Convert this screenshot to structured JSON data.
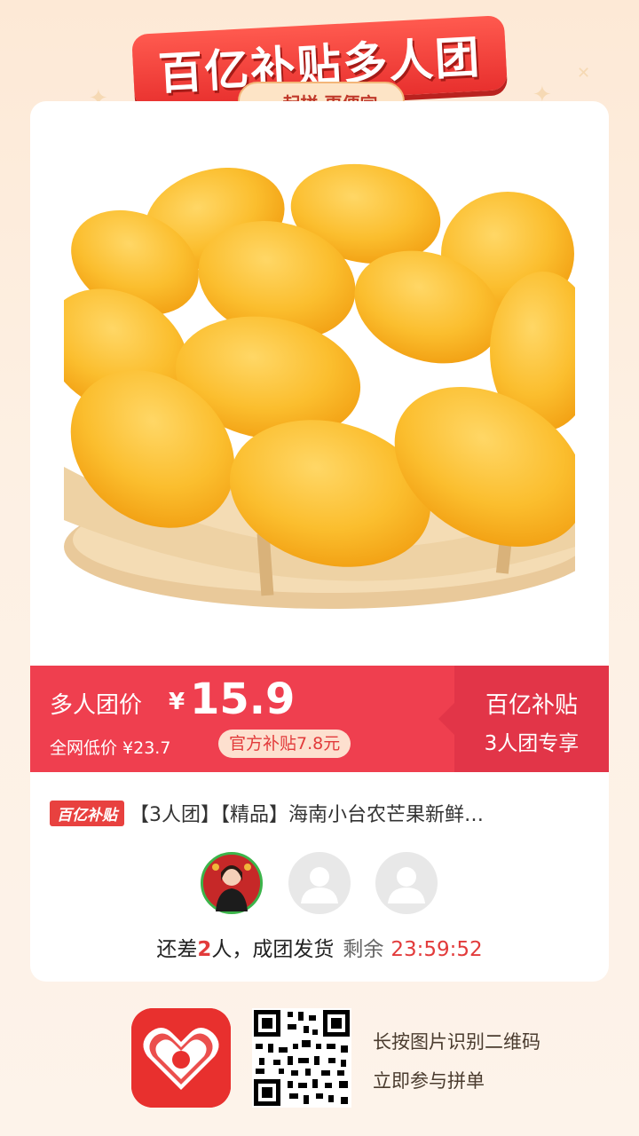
{
  "banner": {
    "title": "百亿补贴多人团",
    "subtitle": "一起拼 更便宜"
  },
  "price": {
    "label": "多人团价",
    "currency": "¥",
    "value": "15.9",
    "market_price": "全网低价 ¥23.7",
    "subsidy": "官方补贴7.8元"
  },
  "promo": {
    "line1": "百亿补贴",
    "line2": "3人团专享"
  },
  "product": {
    "badge": "百亿补贴",
    "title": "【3人团】【精品】海南小台农芒果新鲜…"
  },
  "group": {
    "status_prefix": "还差",
    "remaining_count": "2",
    "status_suffix": "人，成团发货",
    "countdown_label": "剩余",
    "countdown": "23:59:52"
  },
  "footer": {
    "line1": "长按图片识别二维码",
    "line2": "立即参与拼单"
  },
  "icons": [
    "app-logo-icon",
    "qr-code-icon",
    "avatar-placeholder-icon"
  ],
  "colors": {
    "accent": "#ef3f4f",
    "accent_dark": "#e23548",
    "background": "#fdf0e3"
  }
}
